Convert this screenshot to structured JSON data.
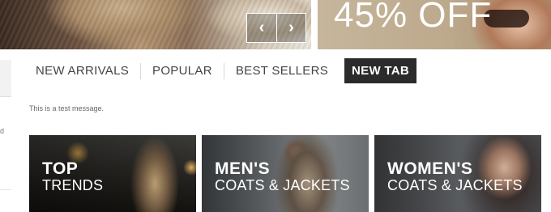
{
  "banner": {
    "promo_text": "45% OFF",
    "prev_icon": "chevron-left-icon",
    "next_icon": "chevron-right-icon",
    "prev_glyph": "‹",
    "next_glyph": "›"
  },
  "sidebar": {
    "fragment_text": "d"
  },
  "tabs": {
    "items": [
      {
        "label": "NEW ARRIVALS"
      },
      {
        "label": "POPULAR"
      },
      {
        "label": "BEST SELLERS"
      },
      {
        "label": "NEW TAB",
        "active": true
      }
    ]
  },
  "content": {
    "message": "This is a test message."
  },
  "categories": [
    {
      "title": "TOP",
      "subtitle": "TRENDS"
    },
    {
      "title": "MEN'S",
      "subtitle": "COATS & JACKETS"
    },
    {
      "title": "WOMEN'S",
      "subtitle": "COATS & JACKETS"
    }
  ],
  "colors": {
    "active_tab_bg": "#2b2b2b",
    "tab_text": "#444444",
    "tile_text": "#ffffff"
  }
}
